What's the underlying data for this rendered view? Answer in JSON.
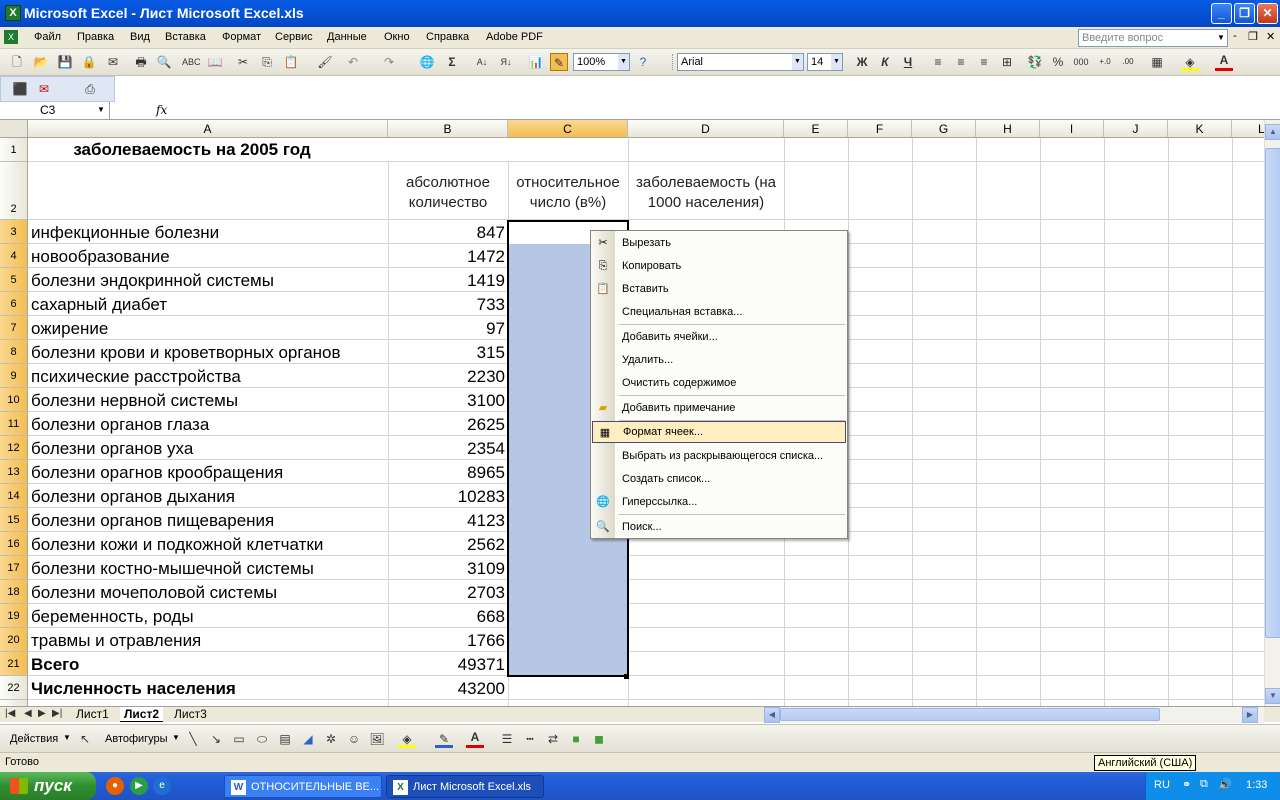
{
  "window": {
    "title": "Microsoft Excel - Лист Microsoft Excel.xls",
    "app_icon": "X"
  },
  "menubar": {
    "items": [
      "Файл",
      "Правка",
      "Вид",
      "Вставка",
      "Формат",
      "Сервис",
      "Данные",
      "Окно",
      "Справка",
      "Adobe PDF"
    ],
    "ask_placeholder": "Введите вопрос"
  },
  "toolbar": {
    "zoom": "100%",
    "font": "Arial",
    "font_size": "14",
    "bold": "Ж",
    "italic": "К",
    "underline": "Ч"
  },
  "formula_bar": {
    "name_box": "C3",
    "fx": "fx",
    "content": ""
  },
  "sheet": {
    "columns": [
      "A",
      "B",
      "C",
      "D",
      "E",
      "F",
      "G",
      "H",
      "I",
      "J",
      "K",
      "L"
    ],
    "selected_column": "C",
    "title": "заболеваемость на 2005 год",
    "header_b": "абсолютное количество",
    "header_c": "относительное число (в%)",
    "header_d": "заболеваемость (на 1000 населения)",
    "rows": [
      {
        "num": "1"
      },
      {
        "num": "2"
      },
      {
        "num": "3",
        "name": "инфекционные болезни",
        "value": "847"
      },
      {
        "num": "4",
        "name": "новообразование",
        "value": "1472"
      },
      {
        "num": "5",
        "name": "болезни эндокринной системы",
        "value": "1419"
      },
      {
        "num": "6",
        "name": "сахарный диабет",
        "value": "733"
      },
      {
        "num": "7",
        "name": "ожирение",
        "value": "97"
      },
      {
        "num": "8",
        "name": "болезни крови и кроветворных органов",
        "value": "315"
      },
      {
        "num": "9",
        "name": "психические расстройства",
        "value": "2230"
      },
      {
        "num": "10",
        "name": "болезни нервной системы",
        "value": "3100"
      },
      {
        "num": "11",
        "name": "болезни органов глаза",
        "value": "2625"
      },
      {
        "num": "12",
        "name": "болезни органов уха",
        "value": "2354"
      },
      {
        "num": "13",
        "name": "болезни орагнов крообращения",
        "value": "8965"
      },
      {
        "num": "14",
        "name": "болезни органов дыхания",
        "value": "10283"
      },
      {
        "num": "15",
        "name": "болезни органов пищеварения",
        "value": "4123"
      },
      {
        "num": "16",
        "name": "болезни кожи и подкожной клетчатки",
        "value": "2562"
      },
      {
        "num": "17",
        "name": "болезни костно-мышечной системы",
        "value": "3109"
      },
      {
        "num": "18",
        "name": "болезни мочеполовой системы",
        "value": "2703"
      },
      {
        "num": "19",
        "name": "беременность, роды",
        "value": "668"
      },
      {
        "num": "20",
        "name": "травмы и отравления",
        "value": "1766"
      },
      {
        "num": "21",
        "name": "Всего",
        "value": "49371",
        "bold": true
      },
      {
        "num": "22",
        "name": "Численность населения",
        "value": "43200",
        "bold": true
      }
    ]
  },
  "context_menu": {
    "items": [
      {
        "label": "Вырезать",
        "icon": "scissors-icon"
      },
      {
        "label": "Копировать",
        "icon": "copy-icon"
      },
      {
        "label": "Вставить",
        "icon": "paste-icon"
      },
      {
        "label": "Специальная вставка...",
        "icon": ""
      },
      {
        "label": "Добавить ячейки...",
        "icon": ""
      },
      {
        "label": "Удалить...",
        "icon": ""
      },
      {
        "label": "Очистить содержимое",
        "icon": ""
      },
      {
        "label": "Добавить примечание",
        "icon": "comment-icon"
      },
      {
        "label": "Формат ячеек...",
        "icon": "format-cells-icon",
        "highlighted": true
      },
      {
        "label": "Выбрать из раскрывающегося списка...",
        "icon": ""
      },
      {
        "label": "Создать список...",
        "icon": ""
      },
      {
        "label": "Гиперссылка...",
        "icon": "hyperlink-icon"
      },
      {
        "label": "Поиск...",
        "icon": "search-icon"
      }
    ]
  },
  "sheet_tabs": [
    "Лист1",
    "Лист2",
    "Лист3"
  ],
  "active_tab": "Лист2",
  "drawing_toolbar": {
    "actions": "Действия",
    "autoshapes": "Автофигуры"
  },
  "statusbar": {
    "status": "Готово",
    "tooltip": "Английский (США)"
  },
  "taskbar": {
    "start": "пуск",
    "tasks": [
      "ОТНОСИТЕЛЬНЫЕ ВЕ...",
      "Лист Microsoft Excel.xls"
    ],
    "lang": "RU",
    "clock": "1:33"
  },
  "colors": {
    "selection": "#b6c7e6",
    "header_selected": "#f4bd52",
    "menu_highlight": "#ffeec2",
    "titlebar": "#0553d8"
  }
}
